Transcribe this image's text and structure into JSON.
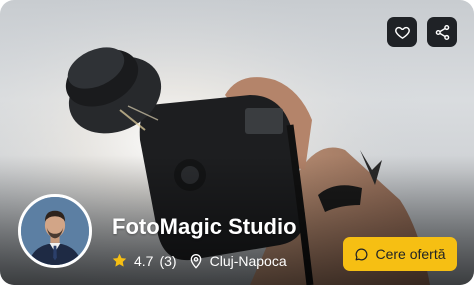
{
  "studio": {
    "name": "FotoMagic Studio",
    "rating": "4.7",
    "reviews": "(3)",
    "location": "Cluj-Napoca"
  },
  "actions": {
    "cta_label": "Cere ofertă",
    "favorite_icon": "heart-icon",
    "share_icon": "share-icon"
  },
  "colors": {
    "accent": "#f6bf13",
    "icon_button_bg": "#1f2226",
    "star": "#f6bf13"
  }
}
